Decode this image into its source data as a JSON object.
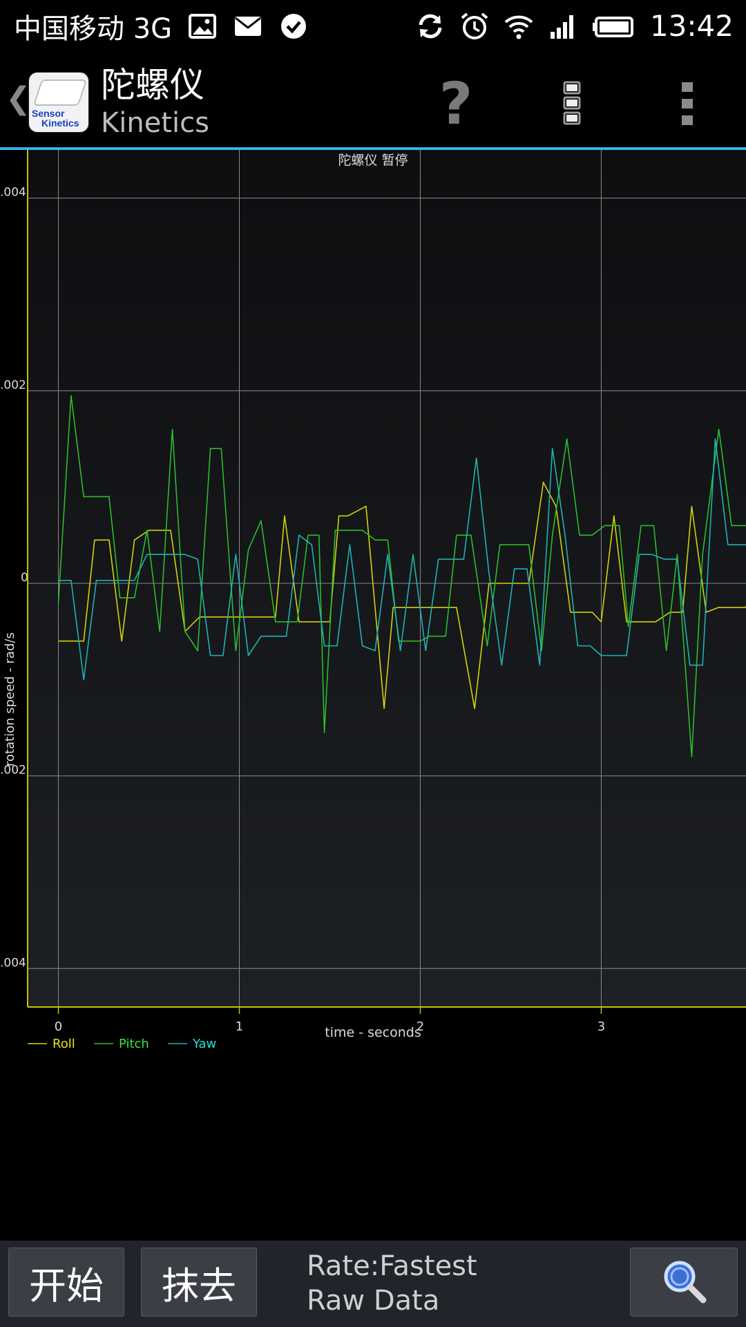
{
  "status_bar": {
    "carrier": "中国移动 3G",
    "time": "13:42",
    "icons": [
      "image-icon",
      "mail-icon",
      "check-circle-icon",
      "sync-icon",
      "alarm-icon",
      "wifi-icon",
      "signal-icon",
      "battery-icon"
    ]
  },
  "action_bar": {
    "title": "陀螺仪",
    "subtitle": "Kinetics",
    "app_icon_text_1": "Sensor",
    "app_icon_text_2": "Kinetics",
    "help_label": "?",
    "icons": [
      "back-chevron-icon",
      "help-icon",
      "menu-list-icon",
      "overflow-menu-icon"
    ],
    "accent_color": "#33b5e5"
  },
  "chart_data": {
    "type": "line",
    "title": "陀螺仪 暂停",
    "xlabel": "time - seconds",
    "ylabel": "rotation speed - rad/s",
    "xlim": [
      -0.17,
      3.8
    ],
    "ylim": [
      -0.0044,
      0.0045
    ],
    "x_ticks": [
      "0",
      "1",
      "2",
      "3"
    ],
    "y_ticks": [
      ".004",
      ".002",
      "0",
      ".002",
      ".004"
    ],
    "y_tick_values": [
      0.004,
      0.002,
      0,
      -0.002,
      -0.004
    ],
    "grid": true,
    "legend_position": "bottom-left",
    "series": [
      {
        "name": "Roll",
        "color": "#d4d20a",
        "points": [
          [
            0,
            -0.0006
          ],
          [
            0.14,
            -0.0006
          ],
          [
            0.2,
            0.00045
          ],
          [
            0.28,
            0.00045
          ],
          [
            0.35,
            -0.0006
          ],
          [
            0.42,
            0.00045
          ],
          [
            0.5,
            0.00055
          ],
          [
            0.62,
            0.00055
          ],
          [
            0.7,
            -0.0005
          ],
          [
            0.78,
            -0.00035
          ],
          [
            1.2,
            -0.00035
          ],
          [
            1.25,
            0.0007
          ],
          [
            1.33,
            -0.0004
          ],
          [
            1.5,
            -0.0004
          ],
          [
            1.55,
            0.0007
          ],
          [
            1.6,
            0.0007
          ],
          [
            1.7,
            0.0008
          ],
          [
            1.8,
            -0.0013
          ],
          [
            1.85,
            -0.00025
          ],
          [
            2.2,
            -0.00025
          ],
          [
            2.3,
            -0.0013
          ],
          [
            2.38,
            0
          ],
          [
            2.6,
            0
          ],
          [
            2.68,
            0.00105
          ],
          [
            2.75,
            0.0008
          ],
          [
            2.83,
            -0.0003
          ],
          [
            2.95,
            -0.0003
          ],
          [
            3.0,
            -0.0004
          ],
          [
            3.07,
            0.0007
          ],
          [
            3.14,
            -0.0004
          ],
          [
            3.3,
            -0.0004
          ],
          [
            3.38,
            -0.0003
          ],
          [
            3.45,
            -0.0003
          ],
          [
            3.5,
            0.0008
          ],
          [
            3.58,
            -0.0003
          ],
          [
            3.65,
            -0.00025
          ],
          [
            3.8,
            -0.00025
          ],
          [
            3.85,
            0.0002
          ]
        ]
      },
      {
        "name": "Pitch",
        "color": "#2bbd2b",
        "points": [
          [
            0,
            -0.0002
          ],
          [
            0.07,
            0.00195
          ],
          [
            0.14,
            0.0009
          ],
          [
            0.28,
            0.0009
          ],
          [
            0.34,
            -0.00015
          ],
          [
            0.42,
            -0.00015
          ],
          [
            0.49,
            0.00055
          ],
          [
            0.56,
            -0.0005
          ],
          [
            0.63,
            0.0016
          ],
          [
            0.7,
            -0.0005
          ],
          [
            0.77,
            -0.0007
          ],
          [
            0.84,
            0.0014
          ],
          [
            0.9,
            0.0014
          ],
          [
            0.98,
            -0.0007
          ],
          [
            1.05,
            0.00035
          ],
          [
            1.12,
            0.00065
          ],
          [
            1.2,
            -0.0004
          ],
          [
            1.32,
            -0.0004
          ],
          [
            1.38,
            0.0005
          ],
          [
            1.44,
            0.0005
          ],
          [
            1.47,
            -0.00155
          ],
          [
            1.53,
            0.00055
          ],
          [
            1.68,
            0.00055
          ],
          [
            1.75,
            0.00045
          ],
          [
            1.82,
            0.00045
          ],
          [
            1.88,
            -0.0006
          ],
          [
            2.0,
            -0.0006
          ],
          [
            2.05,
            -0.00055
          ],
          [
            2.14,
            -0.00055
          ],
          [
            2.2,
            0.0005
          ],
          [
            2.28,
            0.0005
          ],
          [
            2.37,
            -0.00065
          ],
          [
            2.44,
            0.0004
          ],
          [
            2.6,
            0.0004
          ],
          [
            2.67,
            -0.0007
          ],
          [
            2.73,
            0.0005
          ],
          [
            2.81,
            0.0015
          ],
          [
            2.88,
            0.0005
          ],
          [
            2.95,
            0.0005
          ],
          [
            3.02,
            0.0006
          ],
          [
            3.1,
            0.0006
          ],
          [
            3.15,
            -0.00045
          ],
          [
            3.22,
            0.0006
          ],
          [
            3.29,
            0.0006
          ],
          [
            3.36,
            -0.0007
          ],
          [
            3.42,
            0.0003
          ],
          [
            3.5,
            -0.0018
          ],
          [
            3.56,
            0.0003
          ],
          [
            3.65,
            0.0016
          ],
          [
            3.72,
            0.0006
          ],
          [
            3.85,
            0.0006
          ]
        ]
      },
      {
        "name": "Yaw",
        "color": "#1fb3b3",
        "points": [
          [
            0,
            3e-05
          ],
          [
            0.07,
            3e-05
          ],
          [
            0.14,
            -0.001
          ],
          [
            0.21,
            3e-05
          ],
          [
            0.35,
            3e-05
          ],
          [
            0.42,
            3e-05
          ],
          [
            0.49,
            0.0003
          ],
          [
            0.7,
            0.0003
          ],
          [
            0.77,
            0.00025
          ],
          [
            0.84,
            -0.00075
          ],
          [
            0.91,
            -0.00075
          ],
          [
            0.98,
            0.0003
          ],
          [
            1.05,
            -0.00075
          ],
          [
            1.12,
            -0.00055
          ],
          [
            1.26,
            -0.00055
          ],
          [
            1.33,
            0.0005
          ],
          [
            1.4,
            0.0004
          ],
          [
            1.47,
            -0.00065
          ],
          [
            1.54,
            -0.00065
          ],
          [
            1.61,
            0.0004
          ],
          [
            1.68,
            -0.00065
          ],
          [
            1.75,
            -0.0007
          ],
          [
            1.82,
            0.0003
          ],
          [
            1.89,
            -0.0007
          ],
          [
            1.96,
            0.0003
          ],
          [
            2.03,
            -0.0007
          ],
          [
            2.1,
            0.00025
          ],
          [
            2.24,
            0.00025
          ],
          [
            2.31,
            0.0013
          ],
          [
            2.38,
            0.0001
          ],
          [
            2.45,
            -0.00085
          ],
          [
            2.52,
            0.00015
          ],
          [
            2.59,
            0.00015
          ],
          [
            2.66,
            -0.00085
          ],
          [
            2.73,
            0.0014
          ],
          [
            2.8,
            0.0005
          ],
          [
            2.87,
            -0.00065
          ],
          [
            2.94,
            -0.00065
          ],
          [
            3.0,
            -0.00075
          ],
          [
            3.14,
            -0.00075
          ],
          [
            3.21,
            0.0003
          ],
          [
            3.28,
            0.0003
          ],
          [
            3.35,
            0.00025
          ],
          [
            3.42,
            0.00025
          ],
          [
            3.49,
            -0.00085
          ],
          [
            3.56,
            -0.00085
          ],
          [
            3.63,
            0.0015
          ],
          [
            3.7,
            0.0004
          ],
          [
            3.85,
            0.0004
          ]
        ]
      }
    ]
  },
  "bottom_bar": {
    "start_label": "开始",
    "clear_label": "抹去",
    "rate_line1": "Rate:Fastest",
    "rate_line2": "Raw Data",
    "icons": [
      "zoom-icon"
    ]
  }
}
